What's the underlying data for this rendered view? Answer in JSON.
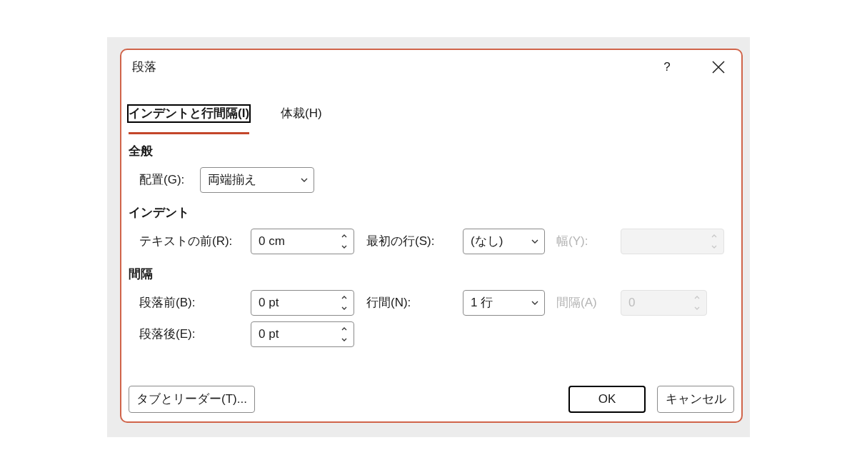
{
  "window": {
    "title": "段落",
    "help": "?"
  },
  "tabs": [
    {
      "label": "インデントと行間隔(I)",
      "selected": true
    },
    {
      "label": "体裁(H)",
      "selected": false
    }
  ],
  "sections": [
    {
      "heading": "全般",
      "rows": [
        {
          "fields": [
            {
              "kind": "dropdown",
              "label": "配置(G):",
              "value": "両端揃え",
              "disabled": false
            }
          ]
        }
      ]
    },
    {
      "heading": "インデント",
      "rows": [
        {
          "fields": [
            {
              "kind": "spinner",
              "label": "テキストの前(R):",
              "value": "0 cm",
              "disabled": false
            },
            {
              "kind": "dropdown",
              "label": "最初の行(S):",
              "value": "(なし)",
              "disabled": false
            },
            {
              "kind": "spinner",
              "label": "幅(Y):",
              "disabled": true
            }
          ]
        }
      ]
    },
    {
      "heading": "間隔",
      "rows": [
        {
          "fields": [
            {
              "kind": "spinner",
              "label": "段落前(B):",
              "value": "0 pt",
              "disabled": false
            },
            {
              "kind": "dropdown",
              "label": "行間(N):",
              "value": "1 行",
              "disabled": false
            },
            {
              "kind": "spinner",
              "label": "間隔(A)",
              "value": "0",
              "disabled": true
            }
          ]
        },
        {
          "fields": [
            {
              "kind": "spinner",
              "label": "段落後(E):",
              "value": "0 pt",
              "disabled": false
            }
          ]
        }
      ]
    }
  ],
  "footer": {
    "left_buttons": [
      {
        "label": "タブとリーダー(T)...",
        "default": false
      }
    ],
    "right_buttons": [
      {
        "label": "OK",
        "default": true
      },
      {
        "label": "キャンセル",
        "default": false
      }
    ]
  }
}
